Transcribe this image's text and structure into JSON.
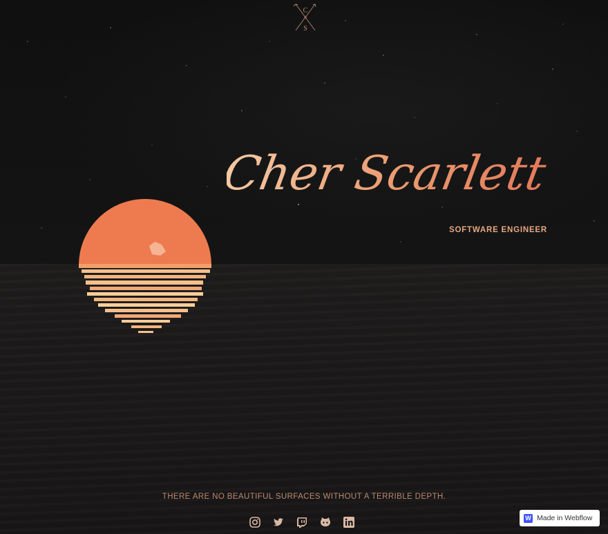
{
  "logo": {
    "letters": [
      "C",
      "S"
    ],
    "icon": "crossed-arrows-monogram-icon"
  },
  "hero": {
    "name": "Cher Scarlett",
    "title": "SOFTWARE ENGINEER"
  },
  "footer": {
    "quote": "THERE ARE NO BEAUTIFUL SURFACES WITHOUT A TERRIBLE DEPTH.",
    "socials": [
      {
        "icon": "instagram-icon"
      },
      {
        "icon": "twitter-icon"
      },
      {
        "icon": "twitch-icon"
      },
      {
        "icon": "github-icon"
      },
      {
        "icon": "linkedin-icon"
      }
    ]
  },
  "badge": {
    "label": "Made in Webflow",
    "logo_letter": "W"
  },
  "colors": {
    "accent": "#e6a781",
    "sun": "#ee7b4f",
    "reflection": "#f6c08c",
    "background": "#121212"
  }
}
